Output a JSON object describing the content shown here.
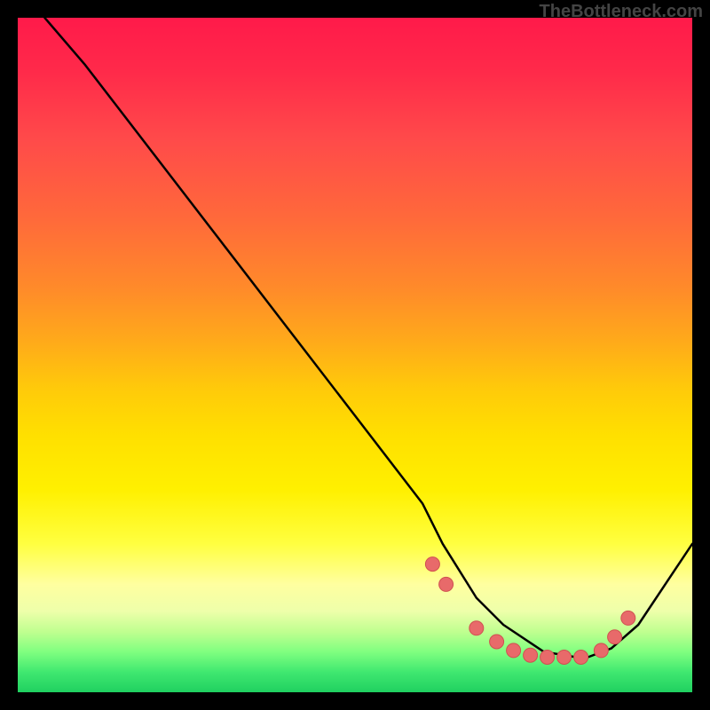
{
  "watermark": "TheBottleneck.com",
  "chart_data": {
    "type": "line",
    "title": "",
    "xlabel": "",
    "ylabel": "",
    "xlim": [
      0,
      100
    ],
    "ylim": [
      0,
      100
    ],
    "series": [
      {
        "name": "curve",
        "x": [
          4,
          10,
          20,
          30,
          40,
          50,
          60,
          63,
          68,
          72,
          78,
          84,
          88,
          92,
          100
        ],
        "y": [
          100,
          93,
          80,
          67,
          54,
          41,
          28,
          22,
          14,
          10,
          6,
          5,
          6.5,
          10,
          22
        ]
      }
    ],
    "markers": {
      "name": "highlighted-points",
      "x": [
        61.5,
        63.5,
        68,
        71,
        73.5,
        76,
        78.5,
        81,
        83.5,
        86.5,
        88.5,
        90.5
      ],
      "y": [
        19,
        16,
        9.5,
        7.5,
        6.2,
        5.5,
        5.2,
        5.2,
        5.2,
        6.2,
        8.2,
        11
      ]
    },
    "background_gradient": {
      "top": "#ff1a4a",
      "mid": "#ffff40",
      "bottom": "#20d060"
    }
  }
}
